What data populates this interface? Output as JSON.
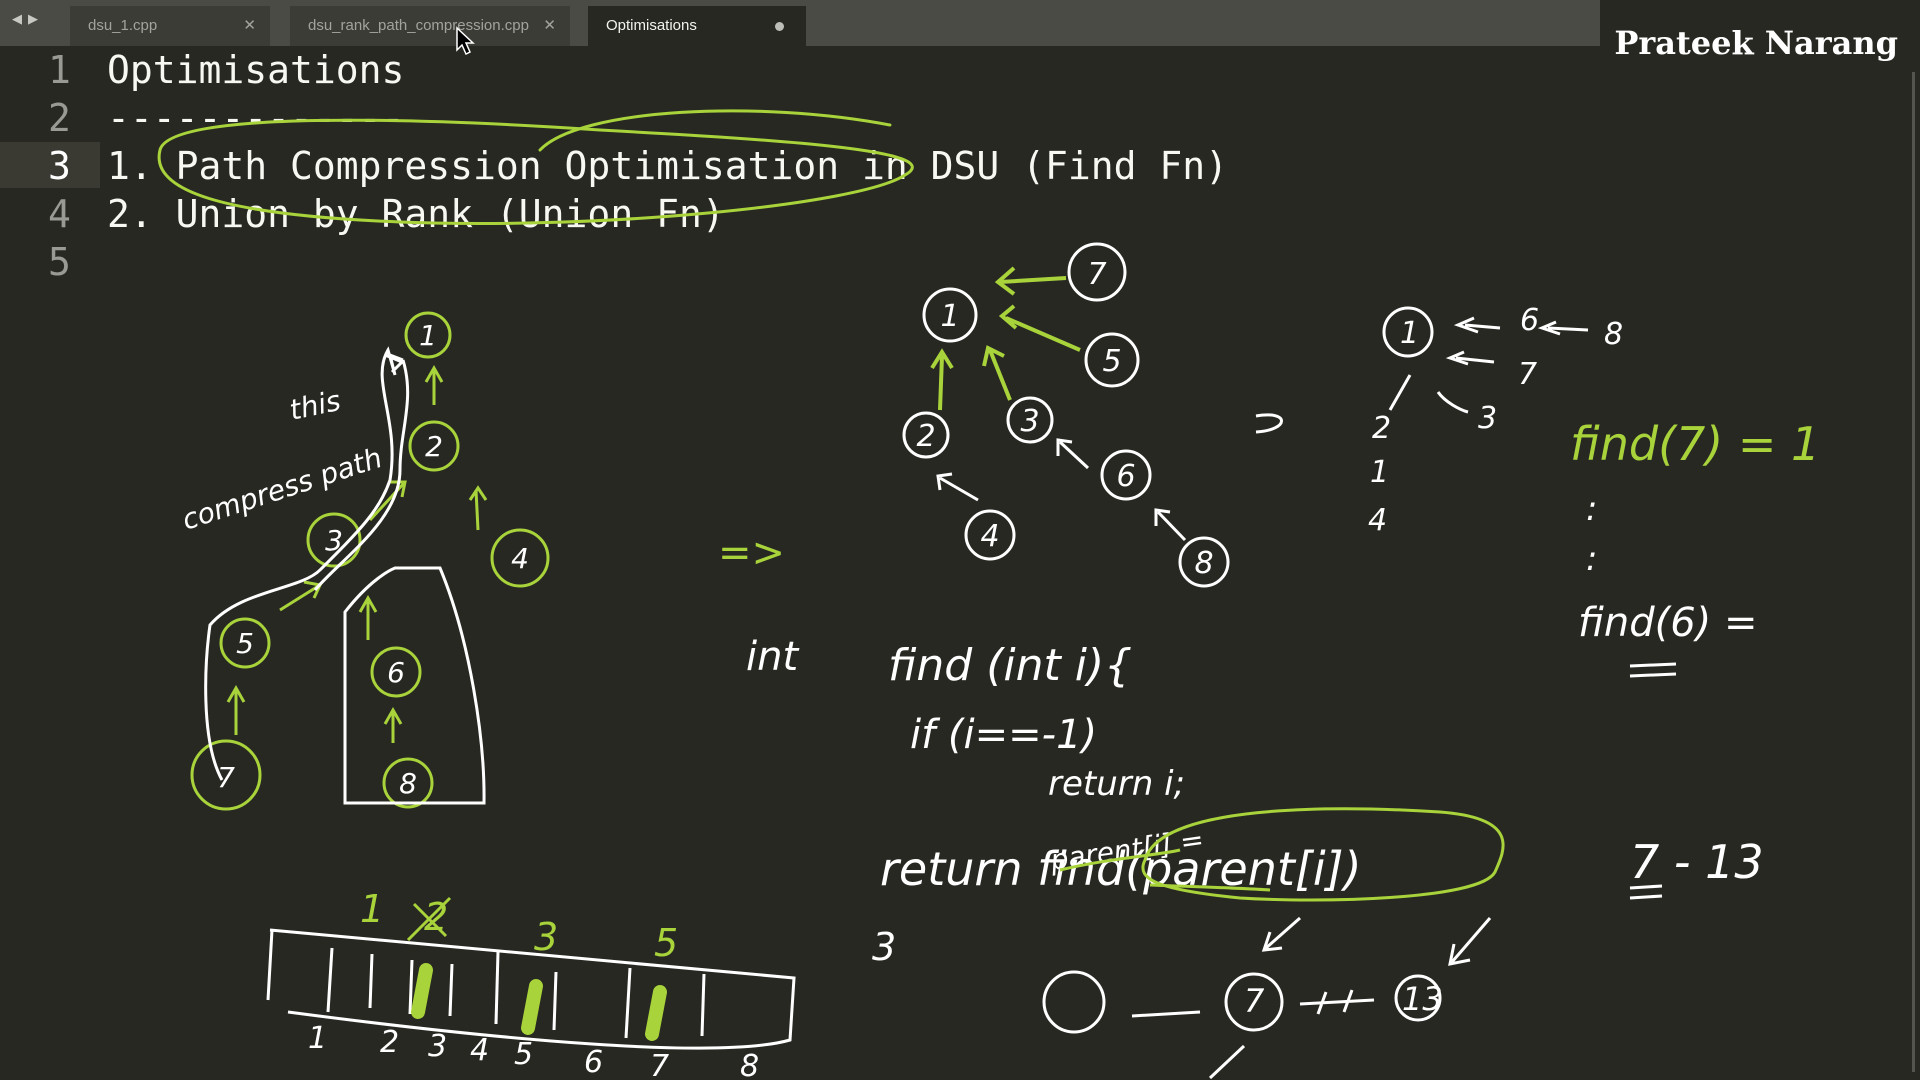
{
  "tabs": [
    {
      "label": "dsu_1.cpp",
      "active": false
    },
    {
      "label": "dsu_rank_path_compression.cpp",
      "active": false
    },
    {
      "label": "Optimisations",
      "active": true,
      "modified": true
    }
  ],
  "watermark": "Prateek Narang",
  "editor": {
    "lines": [
      {
        "number": "1",
        "text": "Optimisations"
      },
      {
        "number": "2",
        "text": "-------------"
      },
      {
        "number": "3",
        "text": "1. Path Compression Optimisation in DSU (Find Fn)"
      },
      {
        "number": "4",
        "text": "2. Union by Rank (Union Fn)"
      },
      {
        "number": "5",
        "text": ""
      }
    ],
    "current_line": "3"
  },
  "annotations": {
    "left_tree": {
      "nodes": [
        "1",
        "2",
        "3",
        "4",
        "5",
        "6",
        "7",
        "8"
      ],
      "note_top": "this",
      "note_side": "compress path"
    },
    "arrow": "=>",
    "middle_tree": {
      "nodes": [
        "1",
        "7",
        "5",
        "2",
        "3",
        "6",
        "4",
        "8"
      ]
    },
    "right_sketch": {
      "row1": [
        "1",
        "6",
        "8"
      ],
      "row2": [
        "7"
      ],
      "row3": [
        "2",
        "3"
      ],
      "row4": [
        "1"
      ],
      "row5": [
        "4"
      ]
    },
    "find_examples": [
      "find(7) = 1",
      ":",
      ":",
      "find(6) ="
    ],
    "code": [
      "int",
      "find (int i){",
      "if (i==-1)",
      "return i;",
      "parent[i] =",
      "return find(parent[i])"
    ],
    "array": {
      "top": [
        "1",
        "2",
        "3",
        "5"
      ],
      "indices": [
        "1",
        "2",
        "3",
        "4",
        "5",
        "6",
        "7",
        "8"
      ]
    },
    "bottom_nodes": [
      "7",
      "13"
    ],
    "misc": [
      "3",
      "7 - 13"
    ]
  },
  "colors": {
    "ink_white": "#ffffff",
    "ink_green": "#a8d33a",
    "bg": "#282823"
  }
}
